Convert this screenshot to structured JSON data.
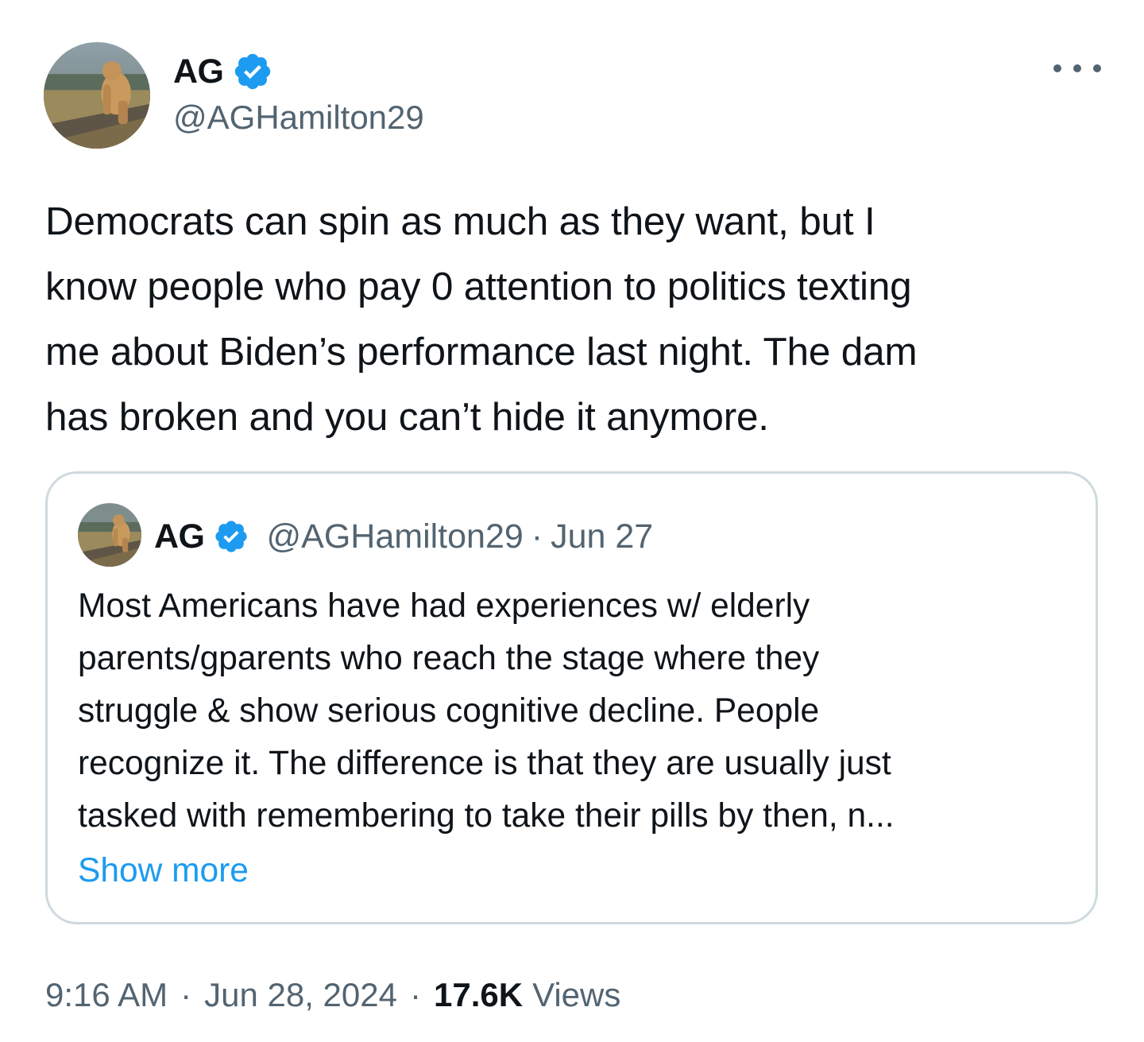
{
  "author": {
    "display_name": "AG",
    "handle": "@AGHamilton29",
    "verified": true
  },
  "tweet": {
    "text": "Democrats can spin as much as they want, but I\nknow people who pay 0 attention to politics texting\nme about Biden’s performance last night. The dam\nhas broken and you can’t hide it anymore."
  },
  "quote": {
    "display_name": "AG",
    "handle": "@AGHamilton29",
    "separator": "·",
    "date": "Jun 27",
    "text": "Most Americans have had experiences w/ elderly\nparents/gparents who reach the stage where they\nstruggle & show serious cognitive decline. People\nrecognize it. The difference is that they are usually just\ntasked with remembering to take their pills by then, n...",
    "show_more": "Show more"
  },
  "meta": {
    "time": "9:16 AM",
    "separator": "·",
    "date": "Jun 28, 2024",
    "views_count": "17.6K",
    "views_label": "Views"
  },
  "icons": {
    "verified": "verified-badge-icon",
    "more": "more-dots-icon"
  },
  "colors": {
    "verified_blue": "#1d9bf0",
    "secondary_text": "#536471",
    "primary_text": "#0f1419",
    "link": "#1d9bf0",
    "card_border": "#cfd9de"
  }
}
